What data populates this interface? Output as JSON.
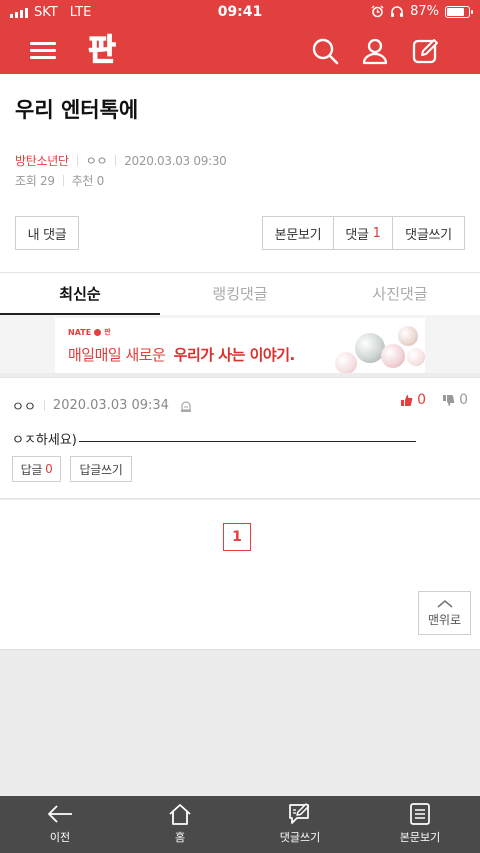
{
  "status_bar": {
    "carrier": "SKT",
    "network": "LTE",
    "time": "09:41",
    "battery": "87%",
    "battery_level": 0.87
  },
  "header": {
    "logo_text": "판",
    "icons": [
      "menu-icon",
      "search-icon",
      "user-icon",
      "write-icon"
    ]
  },
  "article": {
    "title": "우리 엔터톡에",
    "author": "방탄소년단",
    "nickname": "ㅇㅇ",
    "date": "2020.03.03 09:30",
    "views_label": "조회 29",
    "recommend_label": "추천 0"
  },
  "buttons": {
    "my_comments": "내 댓글",
    "view_post": "본문보기",
    "comments_label": "댓글",
    "comments_count": "1",
    "write_comment": "댓글쓰기"
  },
  "tabs": [
    {
      "label": "최신순",
      "active": true
    },
    {
      "label": "랭킹댓글",
      "active": false
    },
    {
      "label": "사진댓글",
      "active": false
    }
  ],
  "ad": {
    "brand": "NATE",
    "brand_sub": "판",
    "text_normal": "매일매일 새로운",
    "text_bold": "우리가 사는 이야기."
  },
  "comment": {
    "nickname": "ㅇㅇ",
    "date": "2020.03.03 09:34",
    "likes": "0",
    "dislikes": "0",
    "text": "ㅇㅈ하세요)",
    "reply_label": "답글",
    "reply_count": "0",
    "write_reply": "답글쓰기"
  },
  "pagination": {
    "current": "1"
  },
  "top_button": {
    "label": "맨위로"
  },
  "bottom_nav": [
    {
      "label": "이전",
      "icon": "back-arrow-icon"
    },
    {
      "label": "홈",
      "icon": "home-icon"
    },
    {
      "label": "댓글쓰기",
      "icon": "comment-write-icon"
    },
    {
      "label": "본문보기",
      "icon": "document-icon"
    }
  ],
  "colors": {
    "brand": "#e2403e",
    "bottom_bar": "#4a4a4a"
  }
}
